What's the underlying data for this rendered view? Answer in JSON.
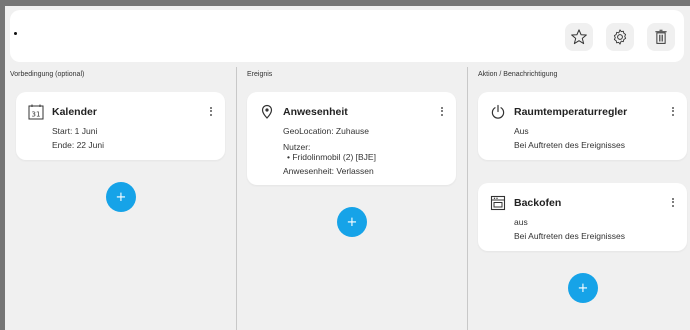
{
  "toolbar": {
    "favorite_icon": "star-icon",
    "settings_icon": "gear-icon",
    "delete_icon": "trash-icon"
  },
  "columns": {
    "condition": {
      "title": "Vorbedingung (optional)",
      "cards": [
        {
          "icon": "calendar-icon",
          "icon_text": "31",
          "title": "Kalender",
          "lines": [
            "Start: 1 Juni",
            "Ende: 22 Juni"
          ]
        }
      ],
      "add_label": "+"
    },
    "event": {
      "title": "Ereignis",
      "cards": [
        {
          "icon": "location-pin-icon",
          "title": "Anwesenheit",
          "lines": [
            "GeoLocation: Zuhause",
            "Nutzer:",
            "• Fridolinmobil (2) [BJE]",
            "Anwesenheit: Verlassen"
          ]
        }
      ],
      "add_label": "+"
    },
    "action": {
      "title": "Aktion / Benachrichtigung",
      "cards": [
        {
          "icon": "power-icon",
          "title": "Raumtemperaturregler",
          "lines": [
            "Aus",
            "Bei Auftreten des Ereignisses"
          ]
        },
        {
          "icon": "oven-icon",
          "title": "Backofen",
          "lines": [
            "aus",
            "Bei Auftreten des Ereignisses"
          ]
        }
      ],
      "add_label": "+"
    }
  },
  "colors": {
    "accent": "#16a3e8",
    "card_background": "#ffffff",
    "page_background": "#f0f0f0",
    "outer_frame": "#757575"
  }
}
